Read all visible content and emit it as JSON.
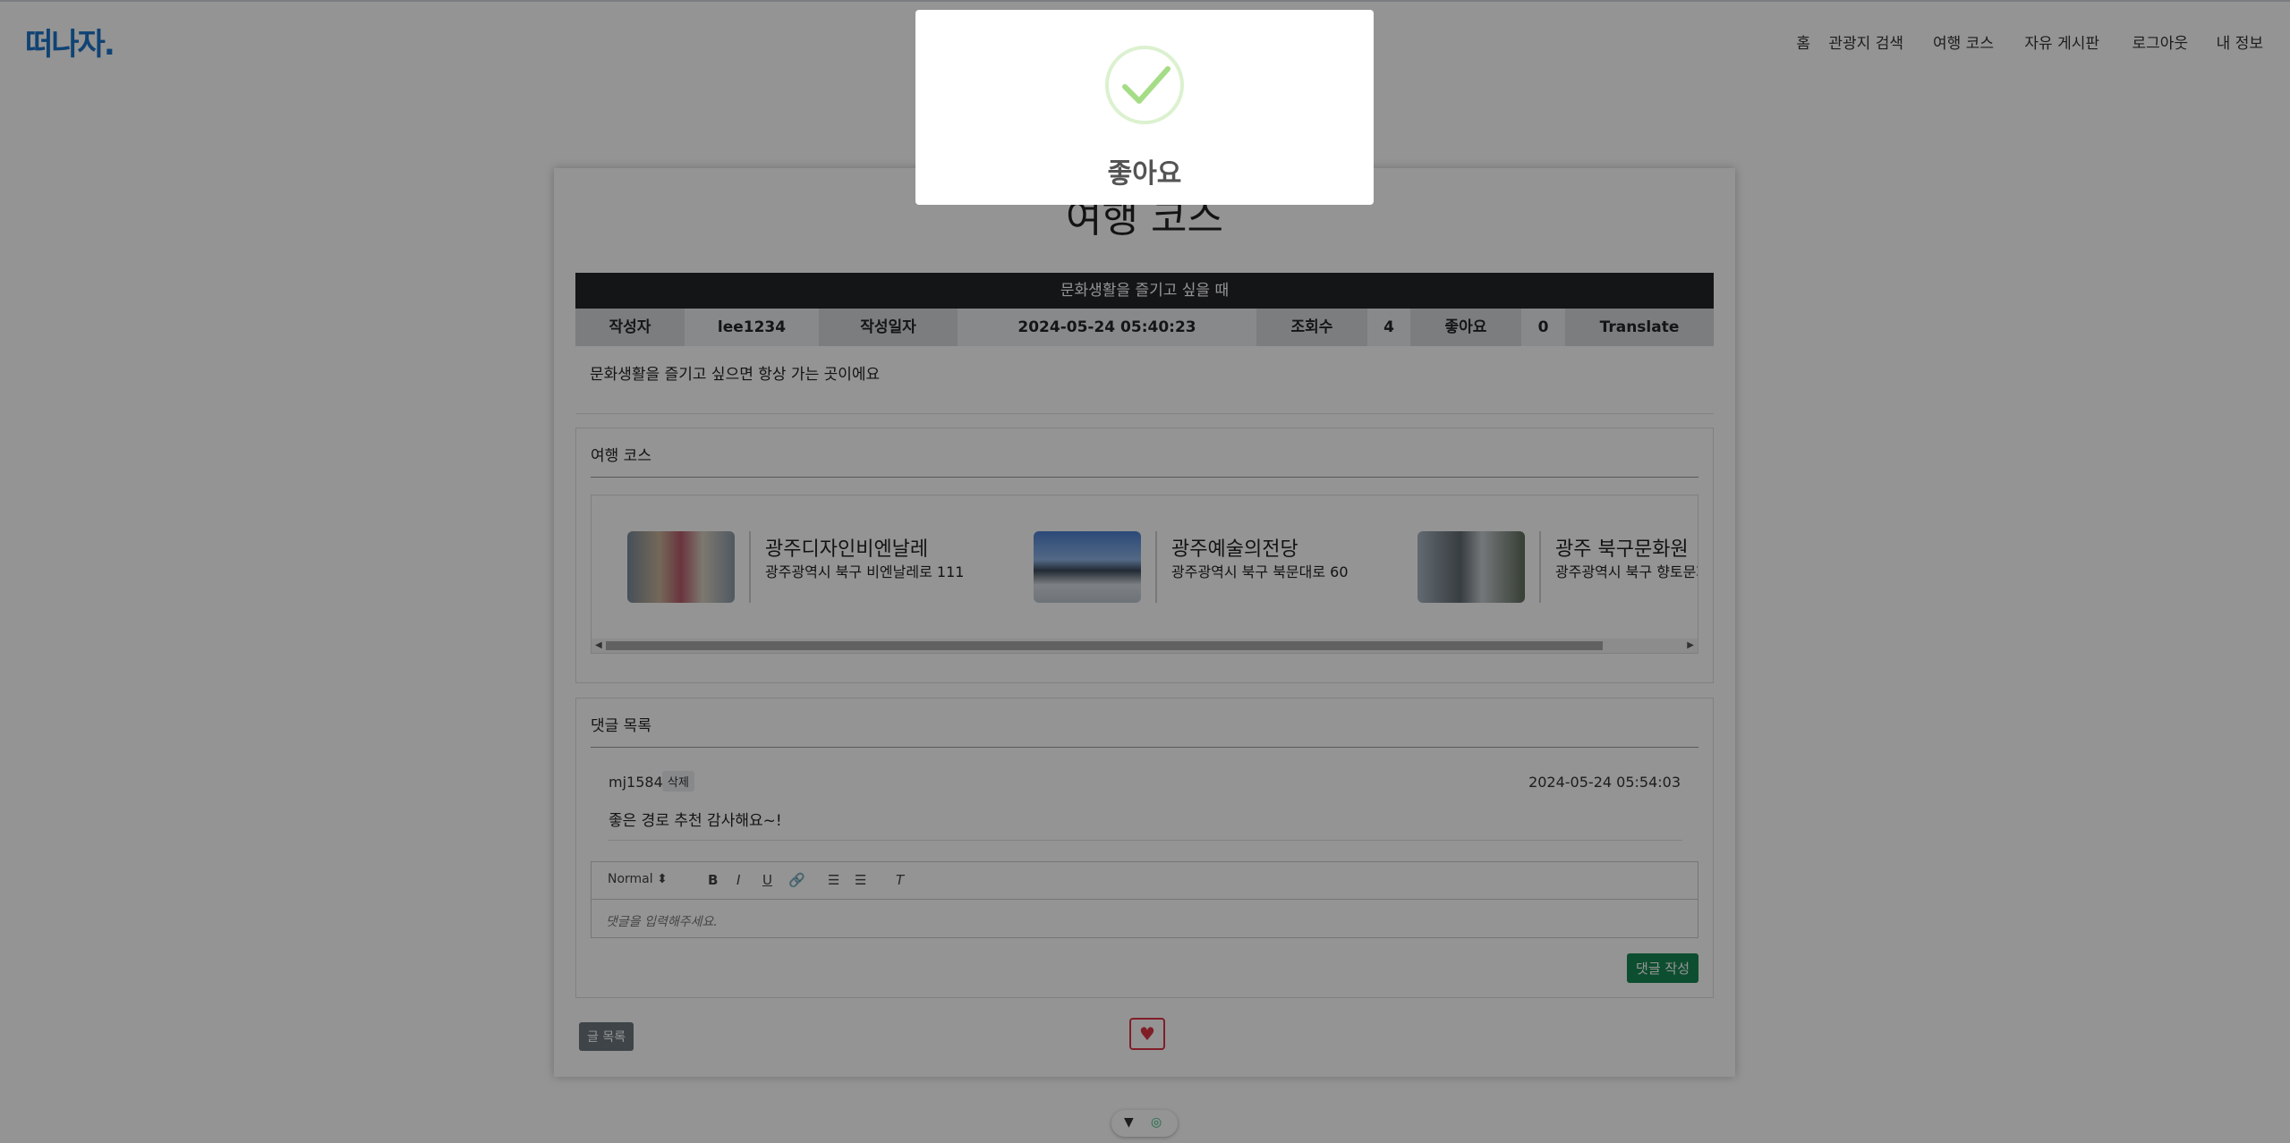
{
  "nav": {
    "logo": "떠나자.",
    "items": [
      "홈",
      "관광지 검색",
      "여행 코스",
      "자유 게시판",
      "로그아웃",
      "내 정보"
    ]
  },
  "page": {
    "title": "여행 코스"
  },
  "post": {
    "title": "문화생활을 즐기고 싶을 때",
    "author_label": "작성자",
    "author": "lee1234",
    "date_label": "작성일자",
    "date": "2024-05-24 05:40:23",
    "views_label": "조회수",
    "views": "4",
    "likes_label": "좋아요",
    "likes": "0",
    "translate_label": "Translate",
    "body": "문화생활을 즐기고 싶으면 항상 가는 곳이에요"
  },
  "course": {
    "title": "여행 코스",
    "items": [
      {
        "name": "광주디자인비엔날레",
        "address": "광주광역시 북구 비엔날레로 111"
      },
      {
        "name": "광주예술의전당",
        "address": "광주광역시 북구 북문대로 60"
      },
      {
        "name": "광주 북구문화원",
        "address": "광주광역시 북구 향토문화"
      }
    ]
  },
  "comments": {
    "title": "댓글 목록",
    "items": [
      {
        "author": "mj1584",
        "delete_label": "삭제",
        "date": "2024-05-24 05:54:03",
        "text": "좋은 경로 추천 감사해요~!"
      }
    ],
    "editor": {
      "format": "Normal",
      "placeholder": "댓글을 입력해주세요."
    },
    "submit_label": "댓글 작성"
  },
  "actions": {
    "list_label": "글 목록",
    "heart": "♥"
  },
  "modal": {
    "title": "좋아요"
  },
  "colors": {
    "accent": "#1d74c9",
    "success": "#198754",
    "danger": "#dc3545",
    "dark": "#212529"
  }
}
